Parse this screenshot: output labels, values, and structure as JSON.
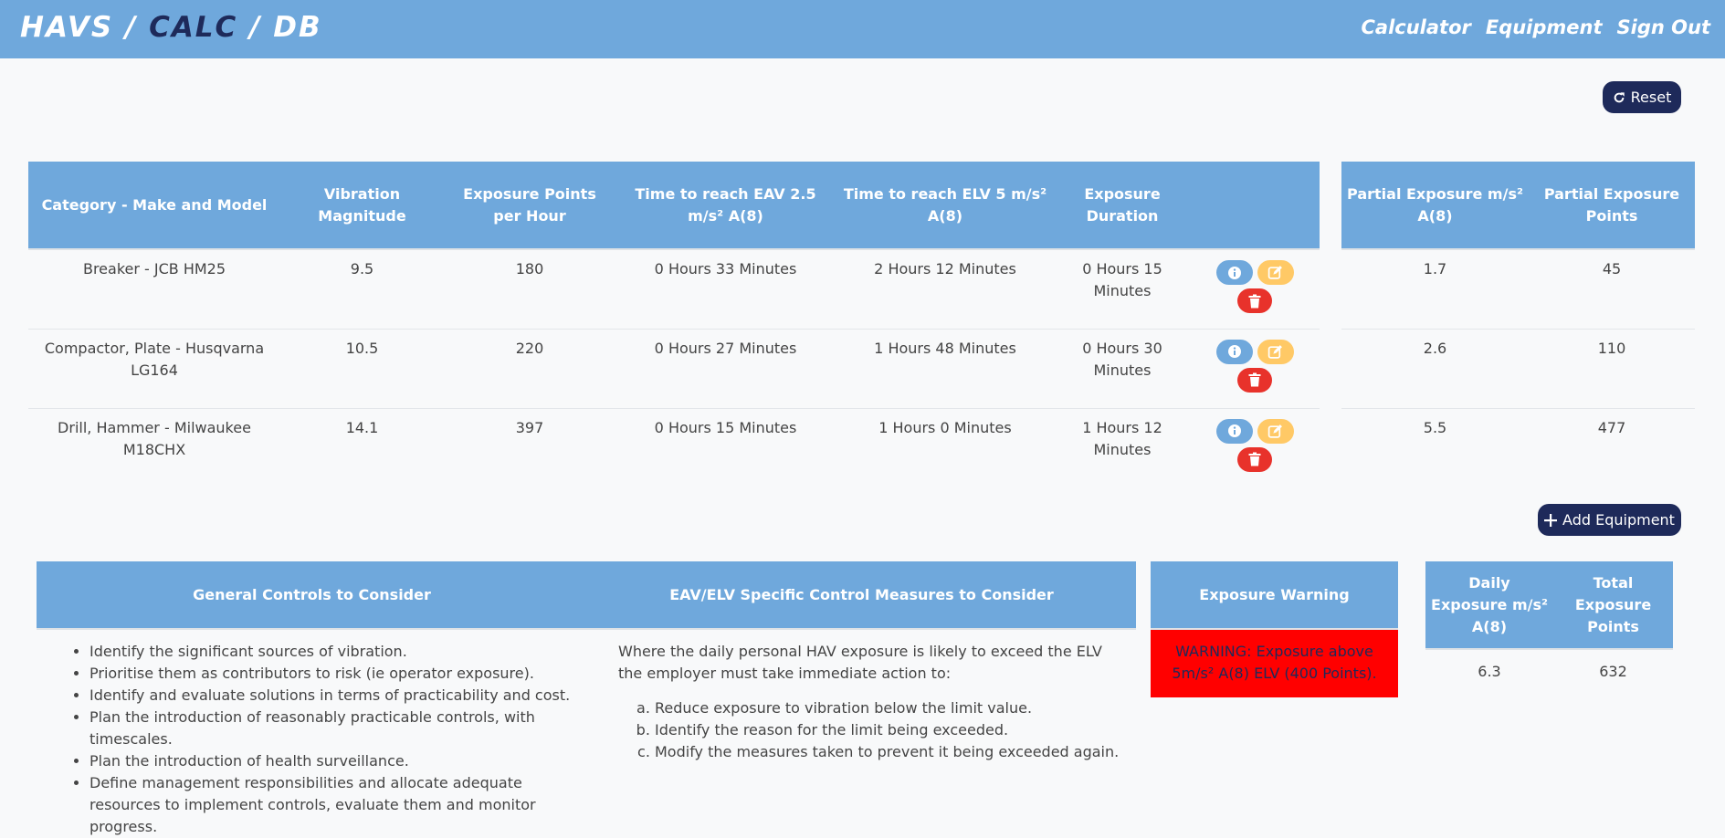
{
  "app": {
    "brand_left": "HAVS / ",
    "brand_mid": "CALC",
    "brand_right": " / DB",
    "nav": [
      "Calculator",
      "Equipment",
      "Sign Out"
    ]
  },
  "reset_label": "Reset",
  "add_equipment_label": "Add Equipment",
  "equipment_table": {
    "headers": [
      "Category - Make and Model",
      "Vibration Magnitude",
      "Exposure Points per Hour",
      "Time to reach EAV 2.5 m/s² A(8)",
      "Time to reach ELV 5 m/s² A(8)",
      "Exposure Duration",
      ""
    ],
    "rows": [
      {
        "name": "Breaker - JCB HM25",
        "magnitude": "9.5",
        "points_per_hour": "180",
        "eav": "0 Hours 33 Minutes",
        "elv": "2 Hours 12 Minutes",
        "duration": "0 Hours 15 Minutes"
      },
      {
        "name": "Compactor, Plate - Husqvarna LG164",
        "magnitude": "10.5",
        "points_per_hour": "220",
        "eav": "0 Hours 27 Minutes",
        "elv": "1 Hours 48 Minutes",
        "duration": "0 Hours 30 Minutes"
      },
      {
        "name": "Drill, Hammer - Milwaukee M18CHX",
        "magnitude": "14.1",
        "points_per_hour": "397",
        "eav": "0 Hours 15 Minutes",
        "elv": "1 Hours 0 Minutes",
        "duration": "1 Hours 12 Minutes"
      }
    ]
  },
  "partial_table": {
    "headers": [
      "Partial Exposure m/s² A(8)",
      "Partial Exposure Points"
    ],
    "rows": [
      {
        "exposure": "1.7",
        "points": "45"
      },
      {
        "exposure": "2.6",
        "points": "110"
      },
      {
        "exposure": "5.5",
        "points": "477"
      }
    ]
  },
  "controls": {
    "general_header": "General Controls to Consider",
    "specific_header": "EAV/ELV Specific Control Measures to Consider",
    "general_items": [
      "Identify the significant sources of vibration.",
      "Prioritise them as contributors to risk (ie operator exposure).",
      "Identify and evaluate solutions in terms of practicability and cost.",
      "Plan the introduction of reasonably practicable controls, with timescales.",
      "Plan the introduction of health surveillance.",
      "Define management responsibilities and allocate adequate resources to implement controls, evaluate them and monitor progress."
    ],
    "specific_lead": "Where the daily personal HAV exposure is likely to exceed the ELV the employer must take immediate action to:",
    "specific_items": [
      "Reduce exposure to vibration below the limit value.",
      "Identify the reason for the limit being exceeded.",
      "Modify the measures taken to prevent it being exceeded again."
    ]
  },
  "warning": {
    "header": "Exposure Warning",
    "text": "WARNING: Exposure above 5m/s² A(8) ELV (400 Points).",
    "color": "#ff0000"
  },
  "daily": {
    "headers": [
      "Daily Exposure m/s² A(8)",
      "Total Exposure Points"
    ],
    "exposure": "6.3",
    "points": "632"
  },
  "colors": {
    "primary": "#6fa8dc",
    "dark": "#1e2a5a",
    "edit": "#ffc966",
    "delete": "#e8322b"
  },
  "icons": {
    "reset": "redo-icon",
    "add": "plus-icon",
    "info": "info-icon",
    "edit": "edit-icon",
    "delete": "trash-icon"
  }
}
